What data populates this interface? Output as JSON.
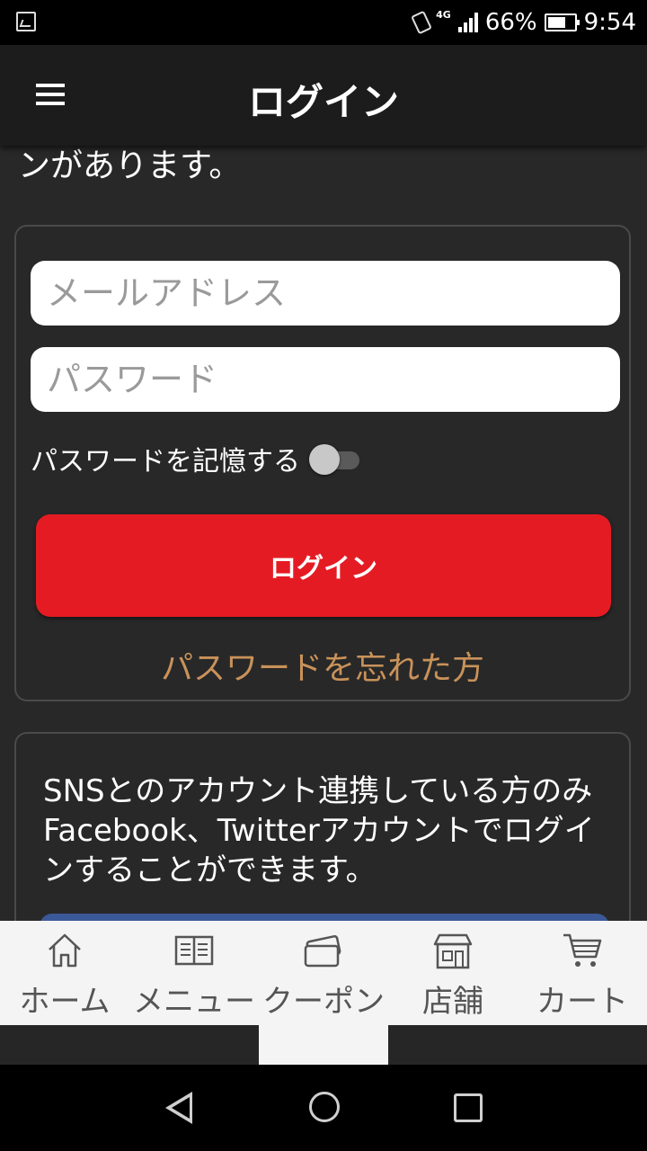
{
  "status_bar": {
    "network": "4G",
    "battery": "66%",
    "time": "9:54"
  },
  "app_bar": {
    "title": "ログイン"
  },
  "intro": {
    "text_line": "ンがあります。"
  },
  "login_form": {
    "email_placeholder": "メールアドレス",
    "password_placeholder": "パスワード",
    "remember_label": "パスワードを記憶する",
    "remember_on": false,
    "login_button": "ログイン",
    "forgot_link": "パスワードを忘れた方"
  },
  "sns": {
    "text": "SNSとのアカウント連携している方のみFacebook、Twitterアカウントでログインすることができます。"
  },
  "bottom_nav": {
    "items": [
      {
        "label": "ホーム",
        "icon": "home-icon"
      },
      {
        "label": "メニュー",
        "icon": "menu-book-icon"
      },
      {
        "label": "クーポン",
        "icon": "coupon-icon"
      },
      {
        "label": "店舗",
        "icon": "store-icon"
      },
      {
        "label": "カート",
        "icon": "cart-icon"
      }
    ]
  }
}
